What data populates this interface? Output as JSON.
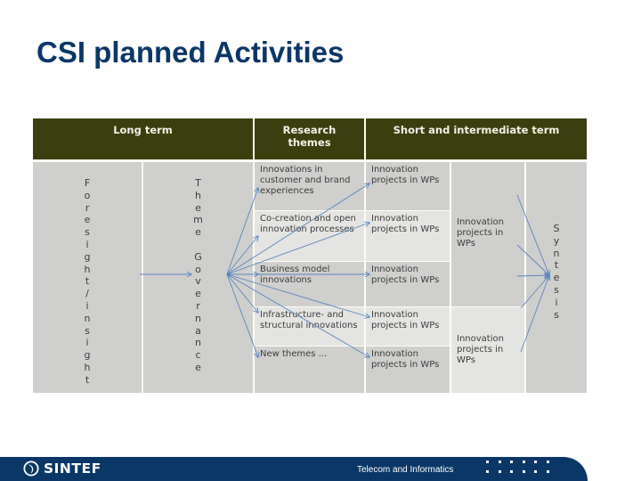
{
  "slide": {
    "title": "CSI planned Activities"
  },
  "diagram": {
    "headers": {
      "long_term": "Long term",
      "research_themes": "Research themes",
      "short_intermediate": "Short and intermediate term"
    },
    "long_term": {
      "foresight_vertical": "Foresight/insight",
      "governance_vertical": "Theme Governance"
    },
    "research_themes": [
      "Innovations in customer and brand experiences",
      "Co-creation and open innovation processes",
      "Business model innovations",
      "Infrastructure- and structural innovations",
      "New themes ..."
    ],
    "wp_projects": [
      "Innovation projects in WPs",
      "Innovation projects in WPs",
      "Innovation projects in WPs",
      "Innovation projects in WPs",
      "Innovation projects in WPs"
    ],
    "grouped_projects": [
      "Innovation projects in WPs",
      "Innovation projects in WPs"
    ],
    "synthesis_vertical": "Syntesis",
    "colors": {
      "header_bg": "#3b3f10",
      "arrow": "#5b86c0"
    }
  },
  "footer": {
    "brand": "SINTEF",
    "department": "Telecom and Informatics"
  }
}
